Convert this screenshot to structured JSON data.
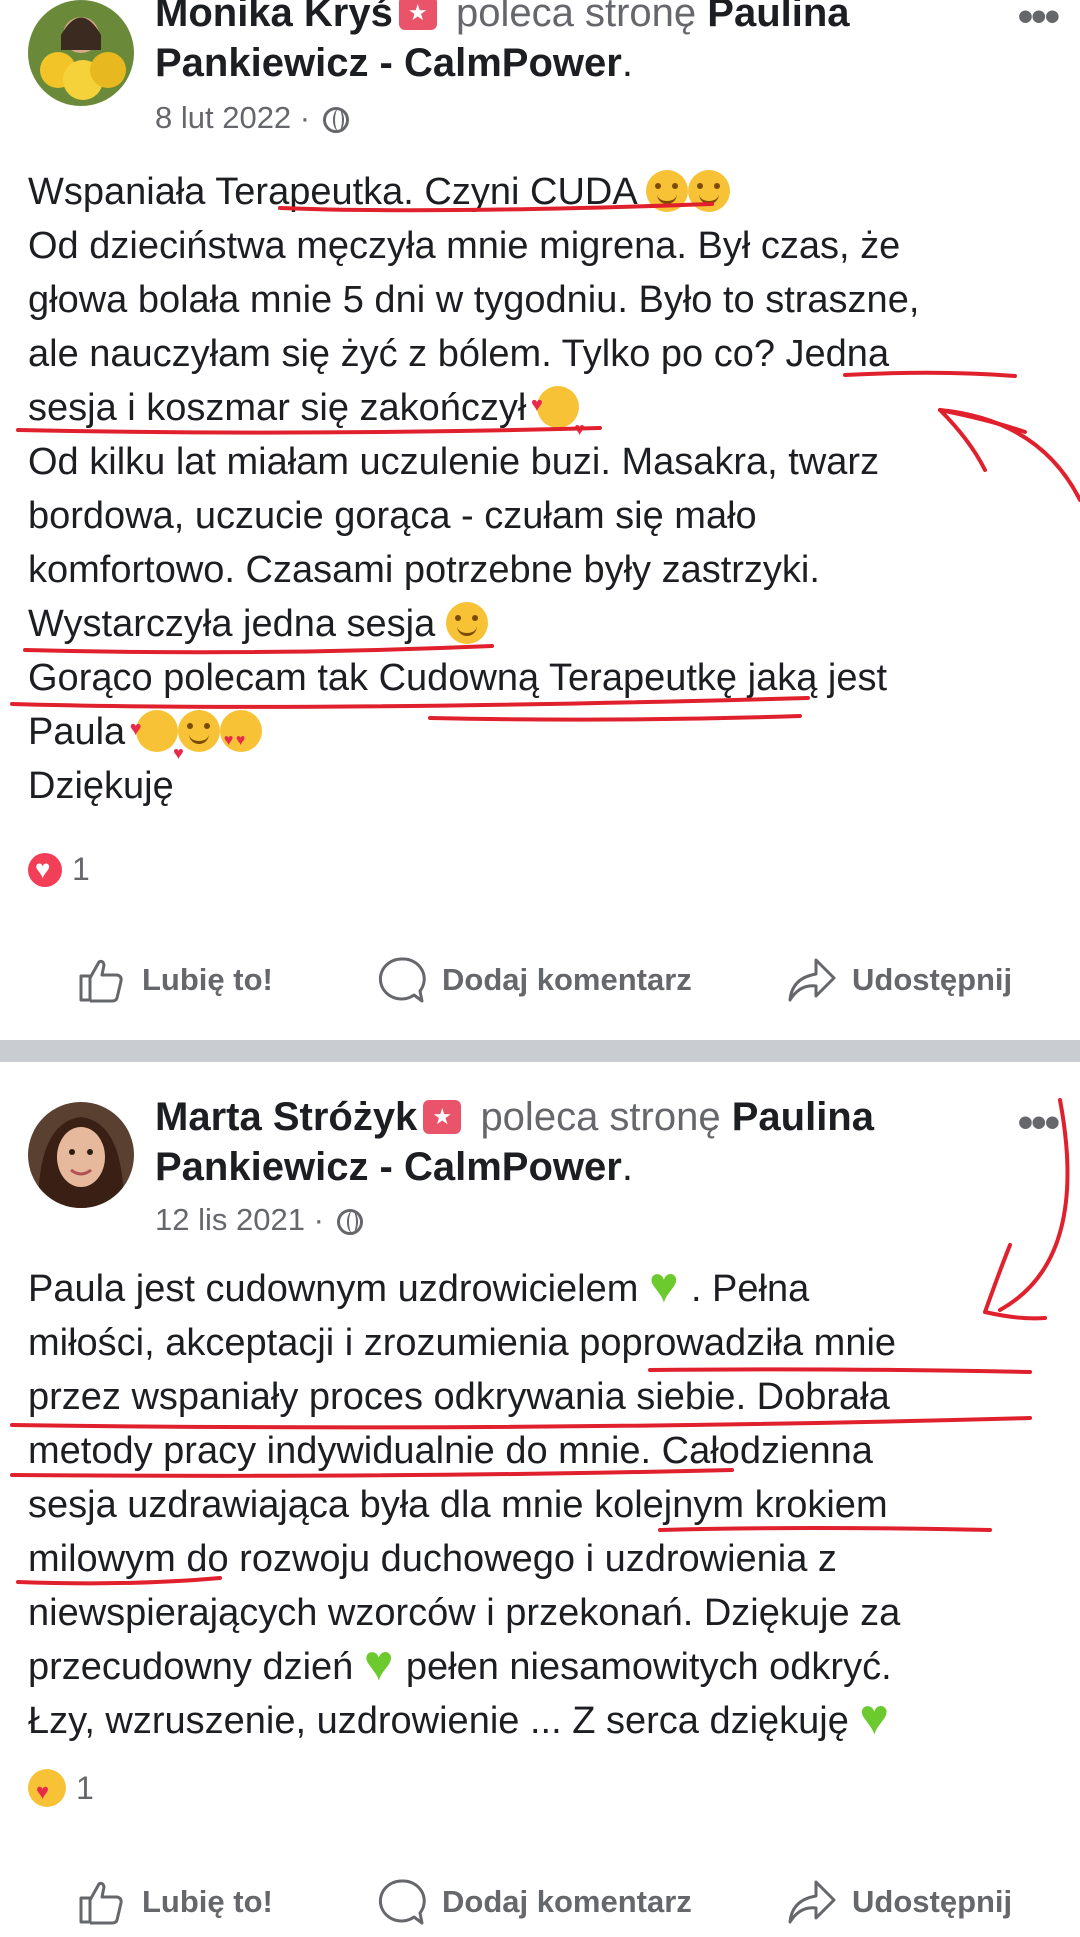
{
  "post1": {
    "author": "Monika Kryś",
    "recommend_text": "poleca stronę",
    "page_name_l1": "Paulina",
    "page_name_l2": "Pankiewicz - CalmPower",
    "period": ".",
    "date": "8 lut 2022",
    "sep": " · ",
    "menu": "•••",
    "lines": [
      "Wspaniała Terapeutka.",
      " Czyni CUDA ",
      "Od dzieciństwa męczyła mnie migrena.  Był czas, że",
      "głowa bolała mnie 5 dni w tygodniu. Było to straszne,",
      "ale nauczyłam się żyć z bólem. Tylko po co?",
      " Jedna",
      "sesja i koszmar się zakończył ",
      "Od kilku lat miałam uczulenie buzi. Masakra, twarz",
      "bordowa, uczucie gorąca - czułam się mało",
      "komfortowo. Czasami potrzebne były zastrzyki.",
      "Wystarczyła jedna sesja ",
      "Gorąco polecam tak Cudowną Terapeutkę",
      " jaką jest",
      "Paula ",
      "Dziękuję"
    ],
    "reaction_count": "1"
  },
  "post2": {
    "author": "Marta Stróżyk",
    "recommend_text": "poleca stronę",
    "page_name_l1": "Paulina",
    "page_name_l2": "Pankiewicz - CalmPower",
    "period": ".",
    "date": "12 lis 2021",
    "sep": " · ",
    "menu": "•••",
    "lines": [
      "Paula jest cudownym uzdrowicielem ",
      ". Pełna",
      "miłości, akceptacji i zrozumienia ",
      "poprowadziła mnie",
      "przez wspaniały  proces odkrywania siebie. Dobrała",
      "metody pracy indywidualnie do mnie.",
      " Całodzienna",
      "sesja uzdrawiająca była dla mnie k",
      "olejnym krokiem",
      "milowym d",
      "o rozwoju duchowego i uzdrowienia z",
      "niewspierających wzorców i przekonań. Dziękuje za",
      "przecudowny dzień ",
      "pełen niesamowitych odkryć.",
      "Łzy, wzruszenie, uzdrowienie ... Z serca dziękuję "
    ],
    "reaction_count": "1"
  },
  "actions": {
    "like": "Lubię to!",
    "comment": "Dodaj komentarz",
    "share": "Udostępnij"
  },
  "colors": {
    "annotation_red": "#e0202c",
    "separator": "#c9ccd1",
    "secondary_text": "#65676b"
  }
}
